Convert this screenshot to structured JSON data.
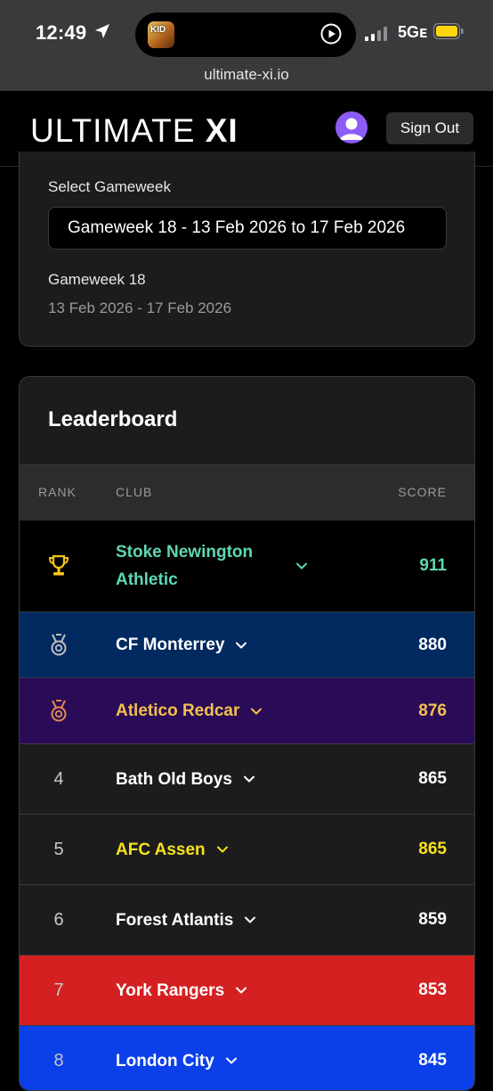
{
  "status_bar": {
    "time": "12:49",
    "island_app_text": "KID",
    "network": "5Gᴇ",
    "url": "ultimate-xi.io"
  },
  "header": {
    "logo_light": "ULTIMATE",
    "logo_bold": "XI",
    "signout_label": "Sign Out"
  },
  "gameweek": {
    "select_label": "Select Gameweek",
    "selected_value": "Gameweek 18 - 13 Feb 2026 to 17 Feb 2026",
    "name": "Gameweek 18",
    "dates": "13 Feb 2026 - 17 Feb 2026"
  },
  "leaderboard": {
    "title": "Leaderboard",
    "columns": {
      "rank": "RANK",
      "club": "CLUB",
      "score": "SCORE"
    },
    "rows": [
      {
        "rank": "1",
        "icon": "trophy-icon",
        "club": "Stoke Newington Athletic",
        "score": "911",
        "bg": "#000000",
        "text_color": "#5fd6b4",
        "icon_color": "#f5c518"
      },
      {
        "rank": "2",
        "icon": "silver-medal-icon",
        "club": "CF Monterrey",
        "score": "880",
        "bg": "#022a61",
        "text_color": "#ffffff",
        "icon_color": "#c0c0c0"
      },
      {
        "rank": "3",
        "icon": "bronze-medal-icon",
        "club": "Atletico Redcar",
        "score": "876",
        "bg": "#2a0b58",
        "text_color": "#f2c14e",
        "icon_color": "#e0894f"
      },
      {
        "rank": "4",
        "icon": "",
        "club": "Bath Old Boys",
        "score": "865",
        "bg": "#1c1c1e",
        "text_color": "#ffffff"
      },
      {
        "rank": "5",
        "icon": "",
        "club": "AFC Assen",
        "score": "865",
        "bg": "#1c1c1e",
        "text_color": "#f7e21b"
      },
      {
        "rank": "6",
        "icon": "",
        "club": "Forest Atlantis",
        "score": "859",
        "bg": "#1c1c1e",
        "text_color": "#ffffff"
      },
      {
        "rank": "7",
        "icon": "",
        "club": "York Rangers",
        "score": "853",
        "bg": "#d42021",
        "text_color": "#ffffff"
      },
      {
        "rank": "8",
        "icon": "",
        "club": "London City",
        "score": "845",
        "bg": "#0b3fe8",
        "text_color": "#ffffff"
      }
    ]
  }
}
